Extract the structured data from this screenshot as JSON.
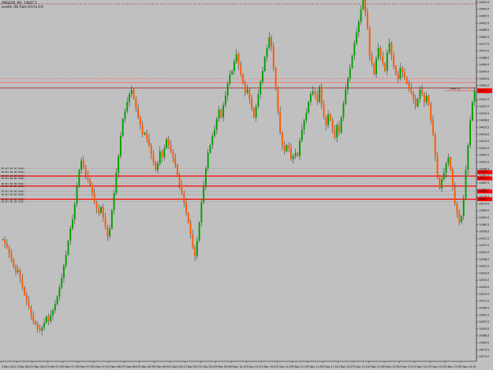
{
  "chart_header": {
    "symbol_line": "#NQ100, M1, 14447.3",
    "comment_line": "Levels: (D) from 0:0 to 0:0"
  },
  "colors": {
    "background": "#c0c0c0",
    "bull_candle": "#00a000",
    "bear_candle": "#ff5a00",
    "wick": "#000000",
    "level_line": "#ff0000",
    "level_thin": "#ff6060",
    "current_price_bg": "#ff0000",
    "ask_line": "#ff2020",
    "grid_dots": "#b00000"
  },
  "current_price": {
    "label": "14447.3",
    "value": 14447.3
  },
  "chart_data": {
    "type": "candlestick",
    "y_axis": {
      "ticks": [
        "14504.5",
        "14500.0",
        "14495.5",
        "14491.0",
        "14486.5",
        "14482.0",
        "14477.5",
        "14473.0",
        "14468.5",
        "14464.0",
        "14459.5",
        "14455.0",
        "14450.5",
        "14446.0",
        "14441.5",
        "14437.0",
        "14432.5",
        "14428.0",
        "14423.5",
        "14419.0",
        "14414.5",
        "14410.0",
        "14405.5",
        "14401.0",
        "14396.5",
        "14392.0",
        "14387.5",
        "14383.0",
        "14378.5",
        "14374.0",
        "14369.5",
        "14365.0",
        "14360.5",
        "14356.0",
        "14351.5",
        "14347.0",
        "14342.5",
        "14338.0",
        "14333.5",
        "14329.0",
        "14324.5",
        "14320.0",
        "14315.5",
        "14311.0",
        "14306.5",
        "14302.0",
        "14297.5",
        "14293.0",
        "14288.5",
        "14284.0",
        "14279.5",
        "14275.0"
      ],
      "range": [
        14272.0,
        14506.0
      ]
    },
    "x_axis": {
      "ticks": [
        "3 Nov 2021",
        "3 Nov 06:31",
        "3 Nov 06:47",
        "3 Nov 07:03",
        "3 Nov 07:19",
        "3 Nov 07:35",
        "3 Nov 07:51",
        "3 Nov 08:07",
        "3 Nov 08:23",
        "3 Nov 08:39",
        "3 Nov 08:55",
        "3 Nov 09:11",
        "3 Nov 09:27",
        "3 Nov 09:43",
        "3 Nov 09:59",
        "3 Nov 10:15",
        "3 Nov 10:31",
        "3 Nov 10:47",
        "3 Nov 11:03",
        "3 Nov 11:19",
        "3 Nov 11:35",
        "3 Nov 11:51",
        "3 Nov 12:07",
        "3 Nov 12:23",
        "3 Nov 12:39",
        "3 Nov 12:55",
        "3 Nov 13:11",
        "3 Nov 13:27",
        "3 Nov 13:43",
        "3 Nov 13:59",
        "3 Nov 14:15"
      ]
    },
    "close_path": [
      14351,
      14348,
      14346,
      14342,
      14338,
      14333,
      14330,
      14331,
      14326,
      14320,
      14315,
      14311,
      14307,
      14302,
      14298,
      14296,
      14293,
      14292,
      14294,
      14297,
      14301,
      14298,
      14302,
      14305,
      14309,
      14314,
      14320,
      14326,
      14334,
      14341,
      14350,
      14358,
      14364,
      14374,
      14385,
      14396,
      14402,
      14398,
      14393,
      14390,
      14386,
      14381,
      14375,
      14371,
      14368,
      14372,
      14365,
      14359,
      14353,
      14358,
      14370,
      14381,
      14394,
      14405,
      14418,
      14429,
      14434,
      14440,
      14445,
      14448,
      14442,
      14436,
      14430,
      14425,
      14419,
      14420,
      14416,
      14412,
      14406,
      14401,
      14396,
      14400,
      14408,
      14404,
      14410,
      14416,
      14412,
      14408,
      14404,
      14399,
      14392,
      14386,
      14381,
      14375,
      14368,
      14362,
      14354,
      14346,
      14340,
      14350,
      14362,
      14375,
      14386,
      14397,
      14407,
      14412,
      14418,
      14422,
      14429,
      14435,
      14430,
      14438,
      14444,
      14452,
      14458,
      14460,
      14466,
      14471,
      14464,
      14458,
      14452,
      14446,
      14448,
      14442,
      14436,
      14430,
      14437,
      14445,
      14453,
      14460,
      14469,
      14475,
      14482,
      14476,
      14462,
      14448,
      14434,
      14420,
      14412,
      14408,
      14412,
      14410,
      14403,
      14405,
      14407,
      14405,
      14415,
      14422,
      14428,
      14433,
      14440,
      14445,
      14447,
      14445,
      14440,
      14450,
      14438,
      14430,
      14425,
      14432,
      14428,
      14422,
      14417,
      14425,
      14420,
      14430,
      14439,
      14448,
      14455,
      14462,
      14470,
      14478,
      14485,
      14492,
      14500,
      14506,
      14498,
      14488,
      14470,
      14465,
      14458,
      14468,
      14475,
      14470,
      14465,
      14460,
      14472,
      14478,
      14470,
      14463,
      14458,
      14455,
      14462,
      14459,
      14456,
      14452,
      14449,
      14446,
      14442,
      14437,
      14442,
      14448,
      14445,
      14440,
      14444,
      14438,
      14428,
      14419,
      14405,
      14392,
      14384,
      14390,
      14394,
      14400,
      14404,
      14396,
      14385,
      14374,
      14368,
      14362,
      14366,
      14378,
      14396,
      14412,
      14428,
      14440,
      14447.3
    ],
    "levels": [
      14397.0,
      14394.5,
      14392.0,
      14390.5,
      14387.0,
      14385.5,
      14382.0,
      14380.0,
      14377.0,
      14375.5
    ],
    "level_labels": [
      "B7:B7.B7.B7.B(B)",
      "B7:B7.B7.B7.B(B)",
      "B7:B7.B7.B7.B(B)",
      "B7:B7.B7.B7.B(B)",
      "B7:B7.B7.B7.B(B)",
      "B7:B7.B7.B7.B(B)",
      "B7:B7.B7.B7.B(B)",
      "B7:B7.B7.B7.B(B)",
      "B7:B7.B7.B7.B(B)",
      "B7:B7.B7.B7.B(B)"
    ],
    "level_price_tags": [
      "14396.9",
      "14391.7",
      "14385.6",
      "14380.0"
    ],
    "resistance_lines": [
      14455.0,
      14452.5,
      14449.0
    ],
    "top_dotted": 14503.5,
    "grid": false,
    "legend": "none"
  }
}
